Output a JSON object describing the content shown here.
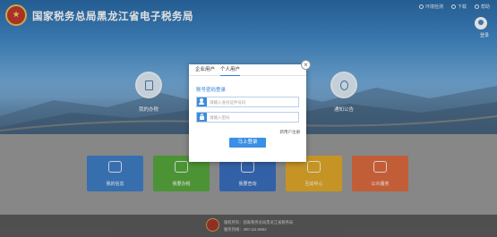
{
  "header": {
    "site_title": "国家税务总局黑龙江省电子税务局",
    "links": [
      "环境检测",
      "下载",
      "帮助"
    ],
    "login_label": "登录"
  },
  "hero": {
    "left_button_label": "我的办税",
    "right_button_label": "通知公告"
  },
  "tiles": [
    {
      "label": "我的信息",
      "color": "#3f7fc6"
    },
    {
      "label": "我要办税",
      "color": "#57a83d"
    },
    {
      "label": "我要查询",
      "color": "#3b6fbf"
    },
    {
      "label": "互动中心",
      "color": "#e1a92a"
    },
    {
      "label": "公众服务",
      "color": "#dd6b3f"
    }
  ],
  "footer": {
    "line1": "版权所有：国家税务总局黑龙江省税务局",
    "line2": "服务热线：400-111-8852"
  },
  "modal": {
    "tabs": [
      "企业用户",
      "个人用户"
    ],
    "active_tab": "个人用户",
    "section_title": "账号密码登录",
    "account_placeholder": "请输入身份证件号码",
    "password_placeholder": "请输入密码",
    "register_link": "新用户注册",
    "submit_label": "马上登录",
    "close_symbol": "×"
  },
  "colors": {
    "accent": "#3b8fe4",
    "active_tab_underline": "#2f7fd8"
  }
}
